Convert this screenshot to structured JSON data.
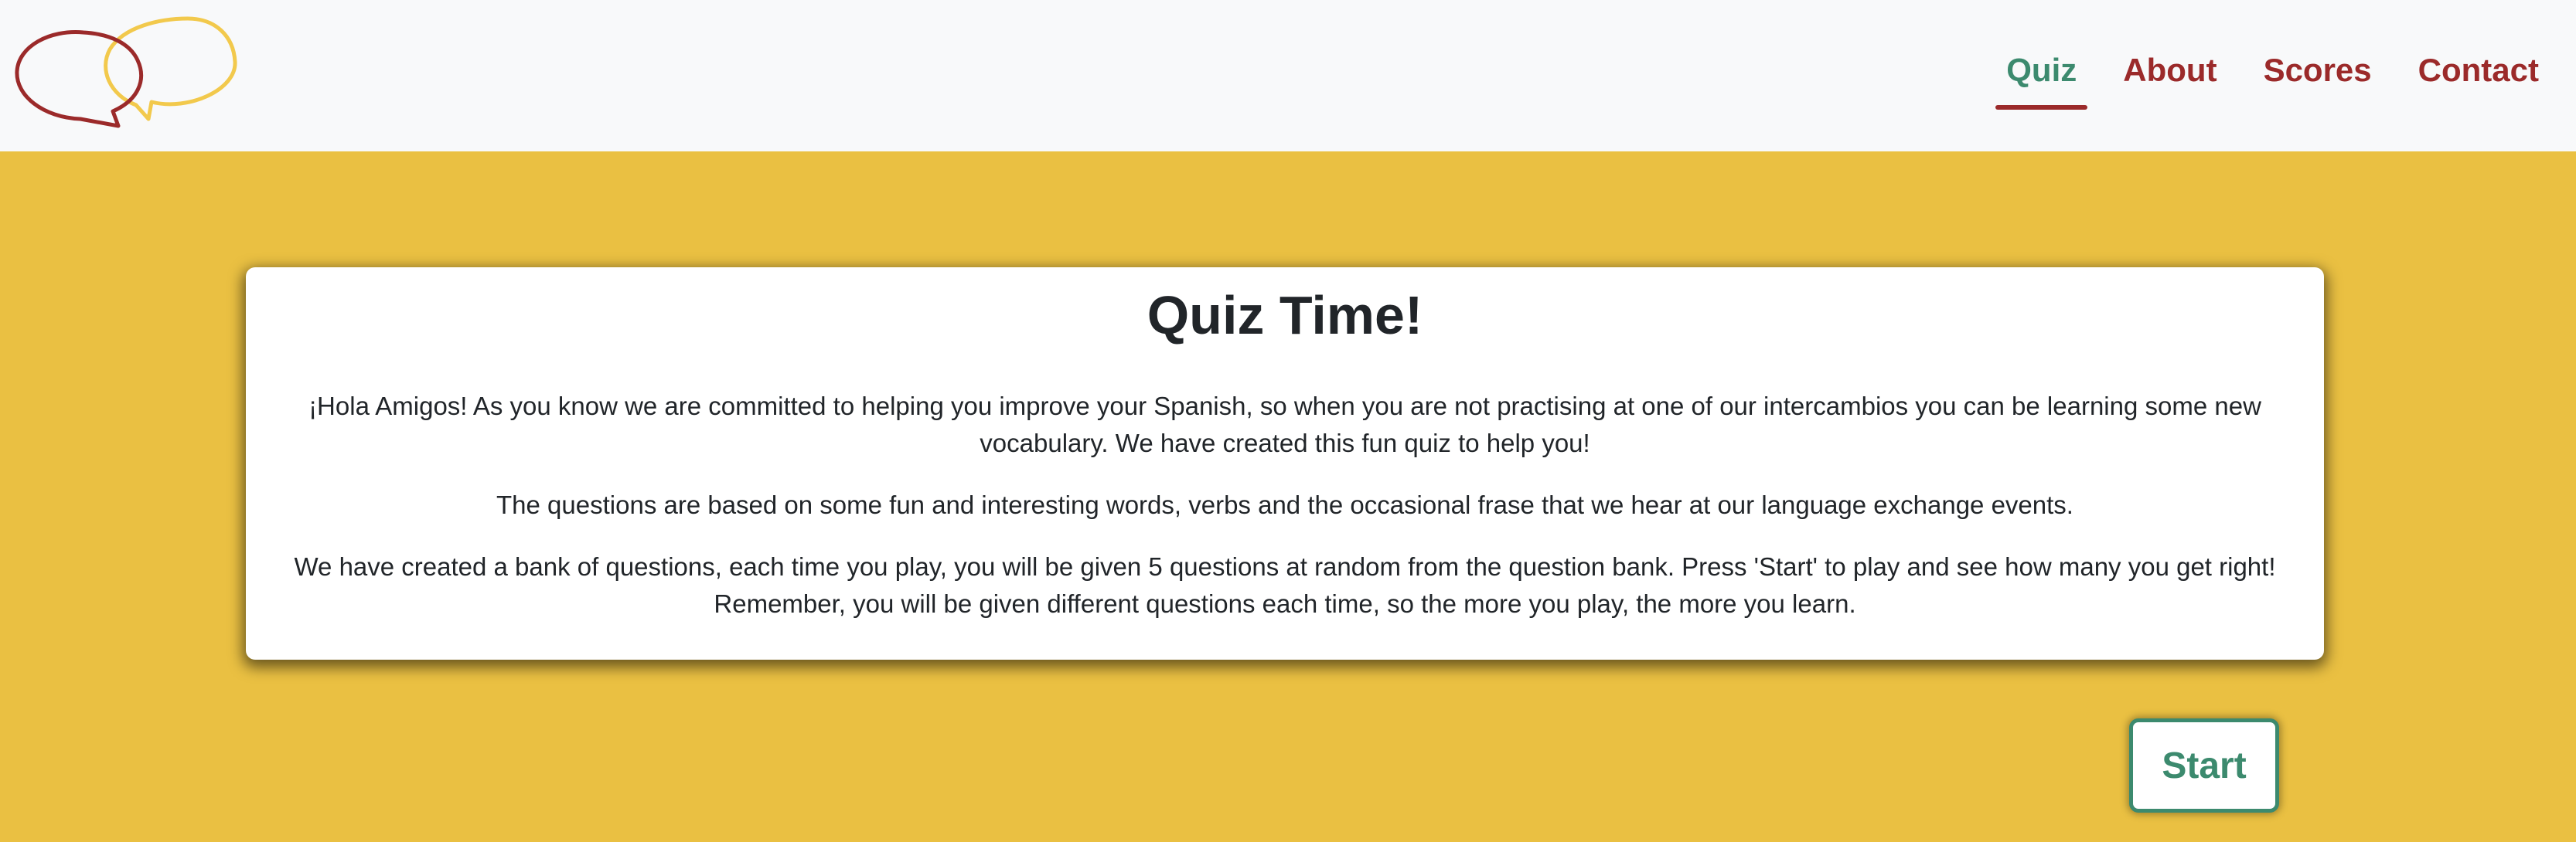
{
  "header": {
    "logo": {
      "icon": "speech-bubbles-logo",
      "colors": {
        "left_bubble": "#9B2A2A",
        "right_bubble": "#F2C94C"
      }
    },
    "nav": [
      {
        "label": "Quiz",
        "active": true
      },
      {
        "label": "About",
        "active": false
      },
      {
        "label": "Scores",
        "active": false
      },
      {
        "label": "Contact",
        "active": false
      }
    ]
  },
  "main": {
    "title": "Quiz Time!",
    "paragraphs": [
      "¡Hola Amigos! As you know we are committed to helping you improve your Spanish, so when you are not practising at one of our intercambios you can be learning some new vocabulary. We have created this fun quiz to help you!",
      "The questions are based on some fun and interesting words, verbs and the occasional frase that we hear at our language exchange events.",
      "We have created a bank of questions, each time you play, you will be given 5 questions at random from the question bank. Press 'Start' to play and see how many you get right! Remember, you will be given different questions each time, so the more you play, the more you learn."
    ],
    "start_label": "Start"
  },
  "colors": {
    "page_background": "#EAC042",
    "header_background": "#F8F9FA",
    "nav_text": "#9B2A2A",
    "nav_active_text": "#3C8A6E",
    "nav_active_underline": "#9B2A2A",
    "button_accent": "#3C8A6E"
  }
}
